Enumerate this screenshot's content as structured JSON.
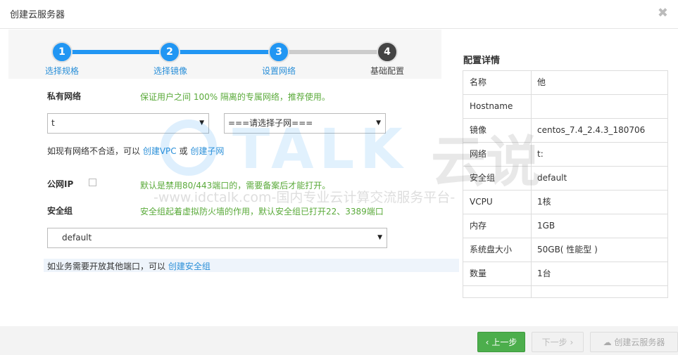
{
  "dialog": {
    "title": "创建云服务器",
    "close_icon": "✖"
  },
  "steps": [
    {
      "num": "1",
      "label": "选择规格"
    },
    {
      "num": "2",
      "label": "选择镜像"
    },
    {
      "num": "3",
      "label": "设置网络"
    },
    {
      "num": "4",
      "label": "基础配置"
    }
  ],
  "network": {
    "label": "私有网络",
    "hint": "保证用户之间 100% 隔离的专属网络，推荐使用。",
    "vpc_value": "t",
    "subnet_value": "===请选择子网===",
    "help_prefix": "如现有网络不合适，可以",
    "create_vpc": "创建VPC",
    "or": "或",
    "create_subnet": "创建子网"
  },
  "public_ip": {
    "label": "公网IP",
    "hint": "默认是禁用80/443端口的，需要备案后才能打开。"
  },
  "security_group": {
    "label": "安全组",
    "hint": "安全组起着虚拟防火墙的作用，默认安全组已打开22、3389端口",
    "value": "default",
    "help_prefix": "如业务需要开放其他端口，可以",
    "create_link": "创建安全组"
  },
  "details": {
    "title": "配置详情",
    "rows": [
      {
        "k": "名称",
        "v": "他"
      },
      {
        "k": "Hostname",
        "v": ""
      },
      {
        "k": "镜像",
        "v": "centos_7.4_2.4.3_180706"
      },
      {
        "k": "网络",
        "v": "t:"
      },
      {
        "k": "安全组",
        "v": "default"
      },
      {
        "k": "VCPU",
        "v": "1核"
      },
      {
        "k": "内存",
        "v": "1GB"
      },
      {
        "k": "系统盘大小",
        "v": "50GB( 性能型 )"
      },
      {
        "k": "数量",
        "v": "1台"
      }
    ]
  },
  "footer": {
    "prev": "上一步",
    "next": "下一步",
    "create": "创建云服务器"
  },
  "watermark": {
    "brand": "TALK",
    "cn": "云说",
    "url": "-www.idctalk.com-国内专业云计算交流服务平台-"
  },
  "colors": {
    "primary": "#2196f3",
    "success": "#4cae4c",
    "hint": "#5aaa3a",
    "link": "#2a8fd8"
  }
}
